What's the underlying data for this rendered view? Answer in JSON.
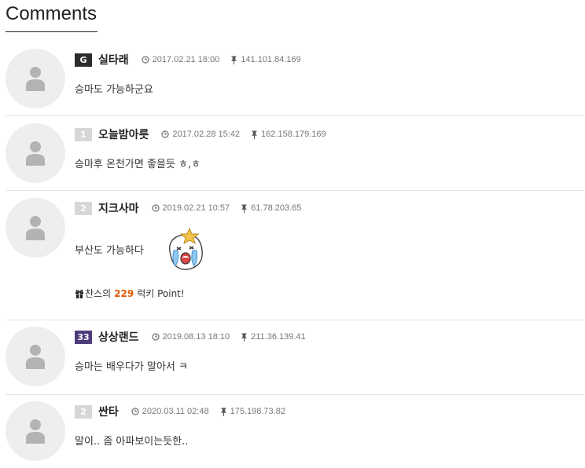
{
  "section_title": "Comments",
  "comments": [
    {
      "badge": "G",
      "nickname": "실타래",
      "datetime": "2017.02.21 18:00",
      "ip": "141.101.84.169",
      "text": "승마도 가능하군요"
    },
    {
      "badge": "1",
      "nickname": "오늘밤아릇",
      "datetime": "2017.02.28 15:42",
      "ip": "162.158.179.169",
      "text": "승마후 온천가면 좋을듯 ㅎ,ㅎ"
    },
    {
      "badge": "2",
      "nickname": "지크사마",
      "datetime": "2019.02.21 10:57",
      "ip": "61.78.203.65",
      "text": "부산도 가능하다",
      "lucky": {
        "prefix": "찬스의",
        "number": "229",
        "suffix": "럭키 Point!"
      }
    },
    {
      "badge": "33",
      "nickname": "상상랜드",
      "datetime": "2019.08.13 18:10",
      "ip": "211.36.139.41",
      "text": "승마는 배우다가 말아서 ㅋ"
    },
    {
      "badge": "2",
      "nickname": "싼타",
      "datetime": "2020.03.11 02:48",
      "ip": "175.198.73.82",
      "text": "말이.. 좀 아파보이는듯한.."
    }
  ],
  "icons": {
    "avatar": "user-silhouette-icon",
    "time": "clock-icon",
    "ip": "pin-icon",
    "gift": "gift-icon",
    "emoji": "crying-face-emoji"
  },
  "colors": {
    "badge_default": "#d7d7d7",
    "badge_dark": "#2c2c2c",
    "badge_purple": "#4d3b7a",
    "lucky_number": "#e25a00"
  }
}
